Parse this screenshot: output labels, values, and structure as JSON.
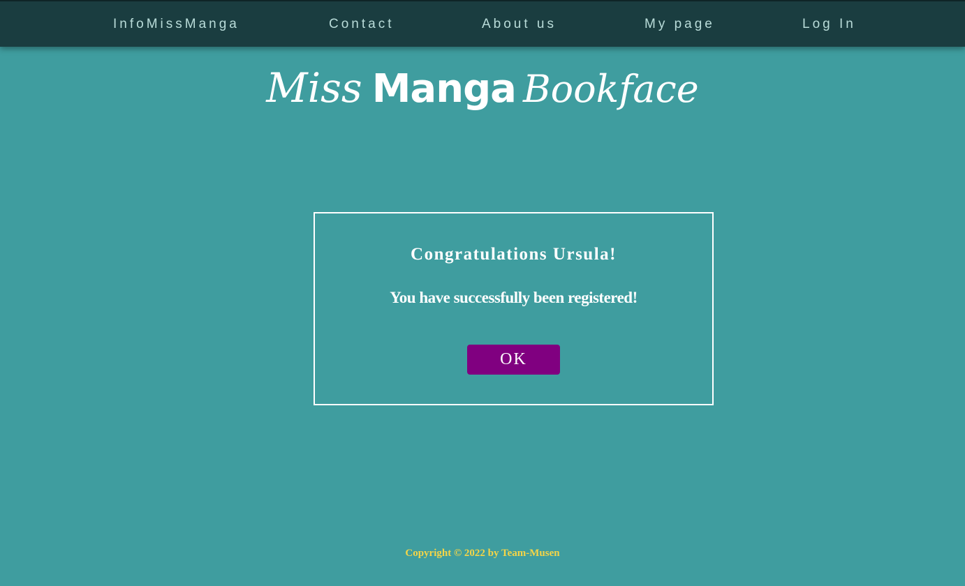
{
  "nav": {
    "items": [
      {
        "label": "InfoMissManga"
      },
      {
        "label": "Contact"
      },
      {
        "label": "About us"
      },
      {
        "label": "My page"
      },
      {
        "label": "Log In"
      }
    ]
  },
  "logo": {
    "part1": "Miss",
    "part2": "Manga",
    "part3": "Bookface"
  },
  "dialog": {
    "title": "Congratulations Ursula!",
    "message": "You have successfully been registered!",
    "ok_label": "OK"
  },
  "footer": {
    "copyright": "Copyright © 2022 by Team-Musen"
  },
  "colors": {
    "background": "#3f9d9f",
    "navbar": "#1a3d40",
    "nav_text": "#b9dcd9",
    "ok_button": "#800080",
    "footer_text": "#f5d547"
  }
}
